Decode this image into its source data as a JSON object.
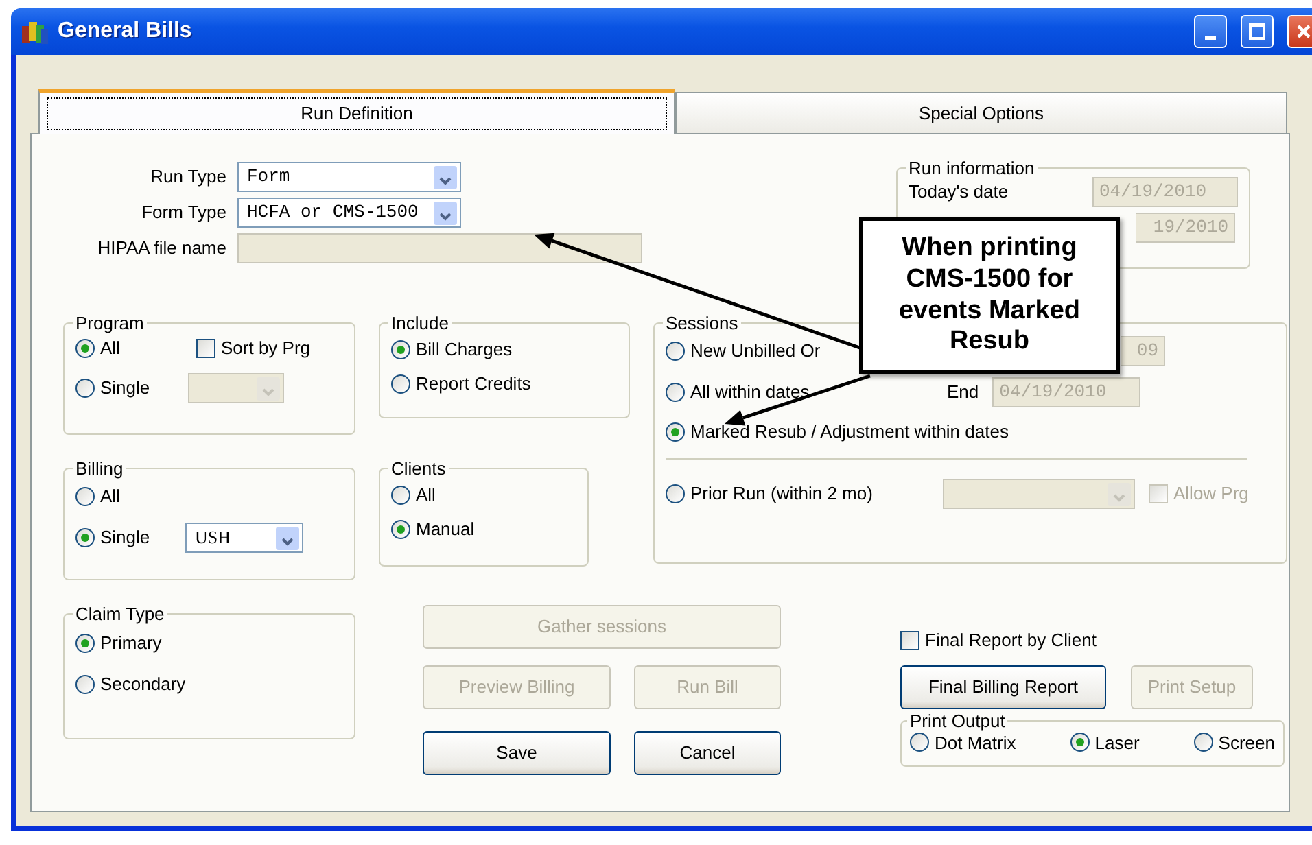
{
  "window": {
    "title": "General Bills"
  },
  "tabs": [
    {
      "label": "Run Definition",
      "selected": true
    },
    {
      "label": "Special Options",
      "selected": false
    }
  ],
  "run_fields": [
    {
      "label": "Run Type",
      "value": "Form",
      "kind": "select"
    },
    {
      "label": "Form Type",
      "value": "HCFA or CMS-1500",
      "kind": "select"
    },
    {
      "label": "HIPAA file name",
      "kind": "text",
      "disabled": true
    }
  ],
  "run_information": {
    "title": "Run information",
    "todays_date_label": "Today's date",
    "todays_date": "04/19/2010",
    "run_date": "19/2010"
  },
  "program": {
    "title": "Program",
    "options": [
      {
        "label": "All",
        "selected": true
      },
      {
        "label": "Single",
        "selected": false
      }
    ],
    "sort": {
      "label": "Sort by Prg",
      "checked": false
    },
    "select": {
      "disabled": true
    }
  },
  "include": {
    "title": "Include",
    "options": [
      {
        "label": "Bill Charges",
        "selected": true
      },
      {
        "label": "Report Credits",
        "selected": false
      }
    ]
  },
  "billing": {
    "title": "Billing",
    "options": [
      {
        "label": "All",
        "selected": false
      },
      {
        "label": "Single",
        "selected": true
      }
    ],
    "select": {
      "value": "USH",
      "disabled": false
    }
  },
  "clients": {
    "title": "Clients",
    "options": [
      {
        "label": "All",
        "selected": false
      },
      {
        "label": "Manual",
        "selected": true
      }
    ]
  },
  "sessions": {
    "title": "Sessions",
    "options": [
      {
        "label": "New Unbilled Or",
        "selected": false
      },
      {
        "label": "All within dates",
        "selected": false
      },
      {
        "label": "Marked Resub / Adjustment within dates",
        "selected": true
      }
    ],
    "start_date": "09",
    "end_label": "End",
    "end_date": "04/19/2010",
    "prior_run": {
      "label": "Prior Run (within 2 mo)",
      "selected": false
    },
    "prior_select": {
      "disabled": true
    },
    "allow_prg": {
      "label": "Allow Prg",
      "checked": false,
      "disabled": true
    }
  },
  "claim_type": {
    "title": "Claim Type",
    "options": [
      {
        "label": "Primary",
        "selected": true
      },
      {
        "label": "Secondary",
        "selected": false
      }
    ]
  },
  "action_buttons": [
    {
      "label": "Gather sessions",
      "disabled": true
    },
    {
      "label": "Preview Billing",
      "disabled": true
    },
    {
      "label": "Run Bill",
      "disabled": true
    },
    {
      "label": "Save",
      "disabled": false
    },
    {
      "label": "Cancel",
      "disabled": false
    }
  ],
  "final_report_by_client": {
    "label": "Final Report by Client",
    "checked": false
  },
  "report_buttons": [
    {
      "label": "Final Billing Report",
      "disabled": false
    },
    {
      "label": "Print Setup",
      "disabled": true
    }
  ],
  "print_output": {
    "title": "Print Output",
    "options": [
      {
        "label": "Dot Matrix",
        "selected": false
      },
      {
        "label": "Laser",
        "selected": true
      },
      {
        "label": "Screen",
        "selected": false
      }
    ]
  },
  "callout": {
    "text": "When printing CMS-1500 for events Marked Resub"
  }
}
